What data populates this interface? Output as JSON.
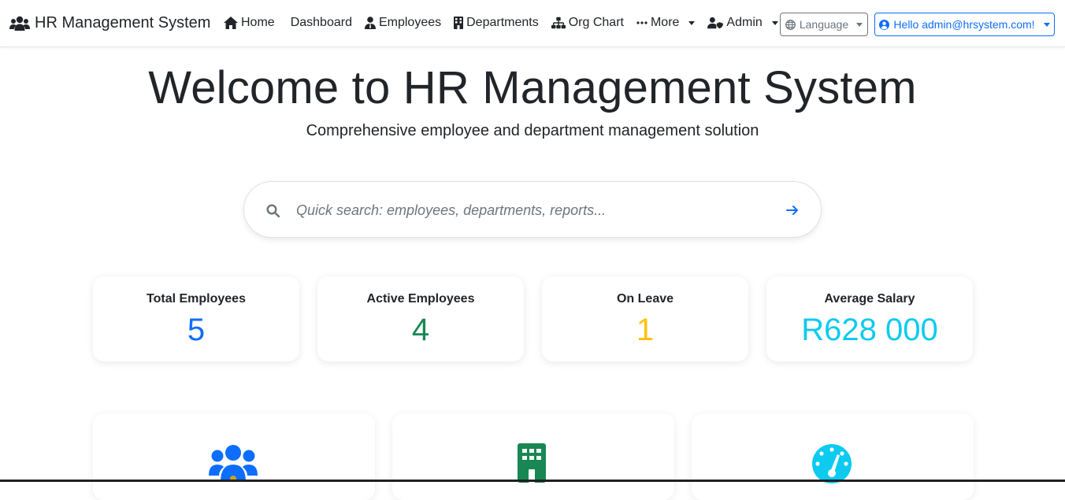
{
  "brand": {
    "title": "HR Management System",
    "icon": "users-icon"
  },
  "nav": {
    "home": "Home",
    "dashboard": "Dashboard",
    "employees": "Employees",
    "departments": "Departments",
    "org_chart": "Org Chart",
    "more": "More",
    "admin": "Admin"
  },
  "language": {
    "label": "Language"
  },
  "user": {
    "greeting": "Hello admin@hrsystem.com!"
  },
  "hero": {
    "title": "Welcome to HR Management System",
    "subtitle": "Comprehensive employee and department management solution"
  },
  "search": {
    "placeholder": "Quick search: employees, departments, reports..."
  },
  "stats": [
    {
      "label": "Total Employees",
      "value": "5",
      "color": "#0d6efd"
    },
    {
      "label": "Active Employees",
      "value": "4",
      "color": "#198754"
    },
    {
      "label": "On Leave",
      "value": "1",
      "color": "#ffc107"
    },
    {
      "label": "Average Salary",
      "value": "R628 000",
      "color": "#0dcaf0"
    }
  ],
  "features": [
    {
      "icon": "users-icon",
      "color": "#0d6efd"
    },
    {
      "icon": "building-icon",
      "color": "#198754"
    },
    {
      "icon": "tachometer-icon",
      "color": "#0dcaf0"
    }
  ],
  "colors": {
    "primary": "#0d6efd",
    "success": "#198754",
    "warning": "#ffc107",
    "info": "#0dcaf0",
    "secondary": "#6c757d"
  }
}
